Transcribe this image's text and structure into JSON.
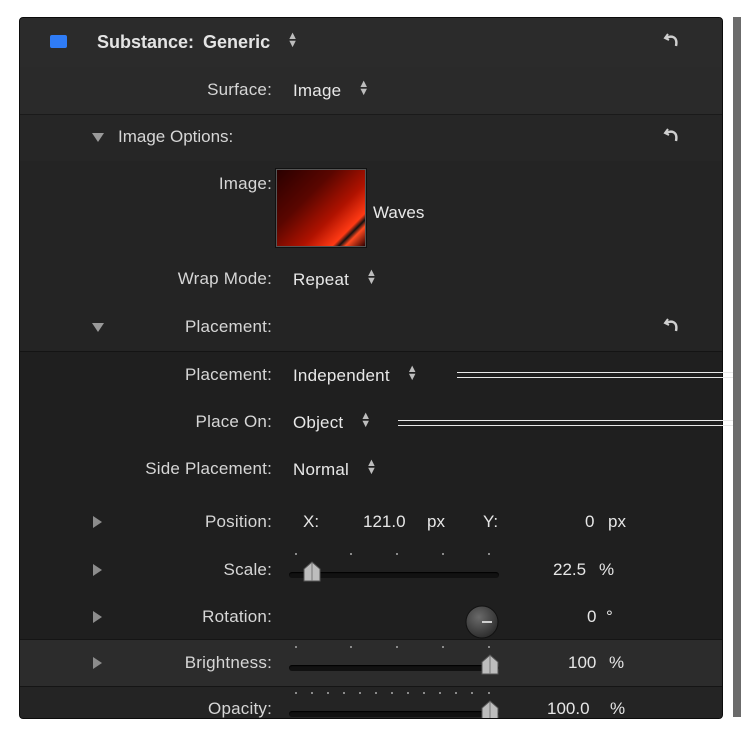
{
  "header": {
    "label": "Substance:",
    "value": "Generic",
    "color_swatch": "#2f7cf6"
  },
  "rows": {
    "surface": {
      "label": "Surface:",
      "value": "Image"
    },
    "image_options": {
      "label": "Image Options:"
    },
    "image": {
      "label": "Image:",
      "name": "Waves"
    },
    "wrap_mode": {
      "label": "Wrap Mode:",
      "value": "Repeat"
    },
    "placement_group": {
      "label": "Placement:"
    },
    "placement": {
      "label": "Placement:",
      "value": "Independent"
    },
    "place_on": {
      "label": "Place On:",
      "value": "Object"
    },
    "side_placement": {
      "label": "Side Placement:",
      "value": "Normal"
    },
    "position": {
      "label": "Position:",
      "x_label": "X:",
      "x_value": "121.0",
      "x_unit": "px",
      "y_label": "Y:",
      "y_value": "0",
      "y_unit": "px"
    },
    "scale": {
      "label": "Scale:",
      "value": "22.5",
      "unit": "%",
      "level": 0.1
    },
    "rotation": {
      "label": "Rotation:",
      "value": "0",
      "unit": "°"
    },
    "brightness": {
      "label": "Brightness:",
      "value": "100",
      "unit": "%",
      "level": 1.0
    },
    "opacity": {
      "label": "Opacity:",
      "value": "100.0",
      "unit": "%",
      "level": 1.0
    }
  },
  "icons": {
    "reset": "reset-arrow-icon",
    "updown": "popup-up-down-icon",
    "disclosure": "disclosure-triangle-icon",
    "dial": "rotation-dial-icon",
    "thumb": "slider-thumb-icon"
  },
  "colors": {
    "panel_bg": "#1e1e1e",
    "header_bg": "#2a2a2a",
    "section_bg": "#262626",
    "accent_orange": "#e8321c"
  }
}
